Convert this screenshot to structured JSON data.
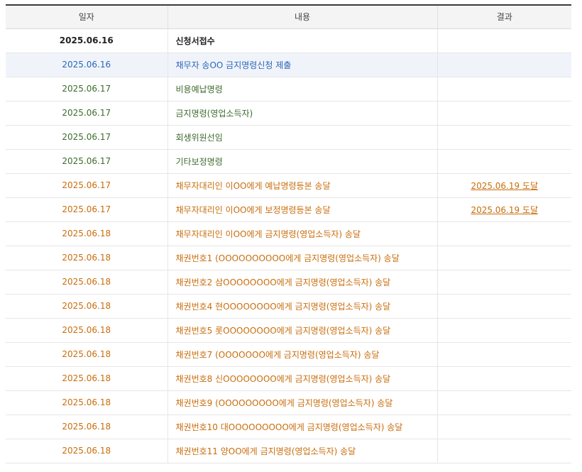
{
  "table": {
    "headers": {
      "date": "일자",
      "content": "내용",
      "result": "결과"
    },
    "rows": [
      {
        "date": "2025.06.16",
        "content": "신청서접수",
        "result": ""
      },
      {
        "date": "2025.06.16",
        "content": "채무자 송OO 금지명령신청 제출",
        "result": ""
      },
      {
        "date": "2025.06.17",
        "content": "비용예납명령",
        "result": ""
      },
      {
        "date": "2025.06.17",
        "content": "금지명령(영업소득자)",
        "result": ""
      },
      {
        "date": "2025.06.17",
        "content": "회생위원선임",
        "result": ""
      },
      {
        "date": "2025.06.17",
        "content": "기타보정명령",
        "result": ""
      },
      {
        "date": "2025.06.17",
        "content": "채무자대리인 이OO에게 예납명령등본 송달",
        "result": "2025.06.19 도달"
      },
      {
        "date": "2025.06.17",
        "content": "채무자대리인 이OO에게 보정명령등본 송달",
        "result": "2025.06.19 도달"
      },
      {
        "date": "2025.06.18",
        "content": "채무자대리인 이OO에게 금지명령(영업소득자) 송달",
        "result": ""
      },
      {
        "date": "2025.06.18",
        "content": "채권번호1 (OOOOOOOOOO에게 금지명령(영업소득자) 송달",
        "result": ""
      },
      {
        "date": "2025.06.18",
        "content": "채권번호2 삼OOOOOOOO에게 금지명령(영업소득자) 송달",
        "result": ""
      },
      {
        "date": "2025.06.18",
        "content": "채권번호4 현OOOOOOOO에게 금지명령(영업소득자) 송달",
        "result": ""
      },
      {
        "date": "2025.06.18",
        "content": "채권번호5 롯OOOOOOOO에게 금지명령(영업소득자) 송달",
        "result": ""
      },
      {
        "date": "2025.06.18",
        "content": "채권번호7 (OOOOOOO에게 금지명령(영업소득자) 송달",
        "result": ""
      },
      {
        "date": "2025.06.18",
        "content": "채권번호8 신OOOOOOOO에게 금지명령(영업소득자) 송달",
        "result": ""
      },
      {
        "date": "2025.06.18",
        "content": "채권번호9 (OOOOOOOOO에게 금지명령(영업소득자) 송달",
        "result": ""
      },
      {
        "date": "2025.06.18",
        "content": "채권번호10 대OOOOOOOOO에게 금지명령(영업소득자) 송달",
        "result": ""
      },
      {
        "date": "2025.06.18",
        "content": "채권번호11 양OO에게 금지명령(영업소득자) 송달",
        "result": ""
      }
    ]
  },
  "colors": {
    "received": "#222222",
    "submitted": "#2a66b8",
    "order": "#3d6b2e",
    "delivery": "#c96d0c"
  }
}
